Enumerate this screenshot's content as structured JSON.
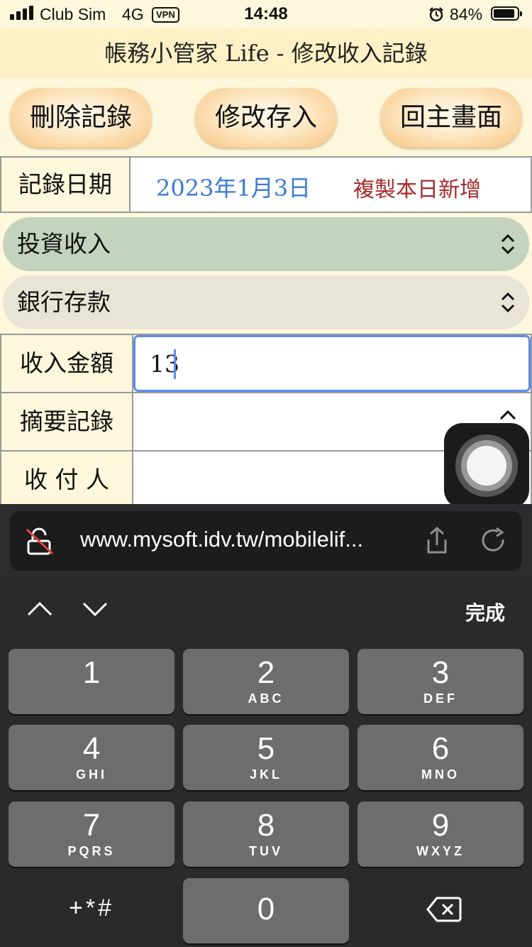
{
  "status": {
    "carrier": "Club Sim",
    "network": "4G",
    "vpn": "VPN",
    "time": "14:48",
    "battery": "84%"
  },
  "title": "帳務小管家 Life - 修改收入記錄",
  "buttons": {
    "delete": "刪除記錄",
    "save": "修改存入",
    "home": "回主畫面"
  },
  "date_row": {
    "label": "記錄日期",
    "value": "2023年1月3日",
    "copy": "複製本日新增"
  },
  "category_select": {
    "value": "投資收入"
  },
  "account_select": {
    "value": "銀行存款"
  },
  "amount_row": {
    "label": "收入金額",
    "value": "13"
  },
  "summary_row": {
    "label": "摘要記錄"
  },
  "payer_row": {
    "label": "收 付 人"
  },
  "browser": {
    "url": "www.mysoft.idv.tw/mobilelif..."
  },
  "keyboard": {
    "done": "完成",
    "keys": [
      {
        "num": "1",
        "letters": ""
      },
      {
        "num": "2",
        "letters": "ABC"
      },
      {
        "num": "3",
        "letters": "DEF"
      },
      {
        "num": "4",
        "letters": "GHI"
      },
      {
        "num": "5",
        "letters": "JKL"
      },
      {
        "num": "6",
        "letters": "MNO"
      },
      {
        "num": "7",
        "letters": "PQRS"
      },
      {
        "num": "8",
        "letters": "TUV"
      },
      {
        "num": "9",
        "letters": "WXYZ"
      },
      {
        "num": "0",
        "letters": ""
      }
    ],
    "symbols": "+*#"
  },
  "colors": {
    "category_bg": "#c3d3be",
    "account_bg": "#e9e5d6",
    "date_blue": "#3a7ad6",
    "copy_red": "#a52a2a",
    "focus": "#5b8cf0"
  }
}
